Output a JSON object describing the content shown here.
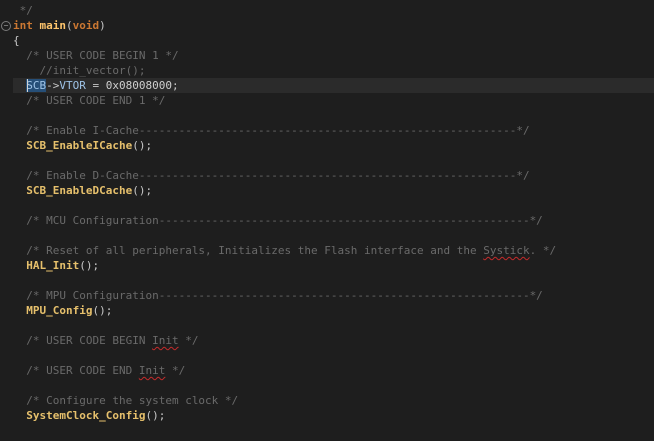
{
  "lines": {
    "l0": {
      "comment": " */"
    },
    "l1": {
      "kw_int": "int",
      "fn_name": "main",
      "open": "(",
      "kw_void": "void",
      "close": ")"
    },
    "l2": {
      "brace": "{"
    },
    "l3": {
      "comment": "/* USER CODE BEGIN 1 */"
    },
    "l4": {
      "comment": "//init_vector();"
    },
    "l5": {
      "sel": "SCB",
      "arrow": "->",
      "member": "VTOR",
      "eq": " = ",
      "num": "0x08008000",
      "semi": ";"
    },
    "l6": {
      "comment": "/* USER CODE END 1 */"
    },
    "l8": {
      "comment": "/* Enable I-Cache---------------------------------------------------------*/"
    },
    "l9": {
      "call": "SCB_EnableICache",
      "rest": "();"
    },
    "l11": {
      "comment": "/* Enable D-Cache---------------------------------------------------------*/"
    },
    "l12": {
      "call": "SCB_EnableDCache",
      "rest": "();"
    },
    "l14": {
      "comment": "/* MCU Configuration--------------------------------------------------------*/"
    },
    "l16": {
      "comment_a": "/* Reset of all peripherals, Initializes the Flash interface and the ",
      "squig": "Systick",
      "comment_b": ". */"
    },
    "l17": {
      "call": "HAL_Init",
      "rest": "();"
    },
    "l19": {
      "comment": "/* MPU Configuration--------------------------------------------------------*/"
    },
    "l20": {
      "call": "MPU_Config",
      "rest": "();"
    },
    "l22": {
      "comment_a": "/* USER CODE BEGIN ",
      "squig": "Init",
      "comment_b": " */"
    },
    "l24": {
      "comment_a": "/* USER CODE END ",
      "squig": "Init",
      "comment_b": " */"
    },
    "l26": {
      "comment": "/* Configure the system clock */"
    },
    "l27": {
      "call": "SystemClock_Config",
      "rest": "();"
    }
  },
  "colors": {
    "background": "#1e1e1e",
    "comment": "#6a6a6a",
    "keyword": "#cc7832",
    "function": "#ffc66d",
    "selection": "#264f78",
    "squiggle": "#c42b2b"
  },
  "icons": {
    "fold": "collapse-minus-icon"
  }
}
